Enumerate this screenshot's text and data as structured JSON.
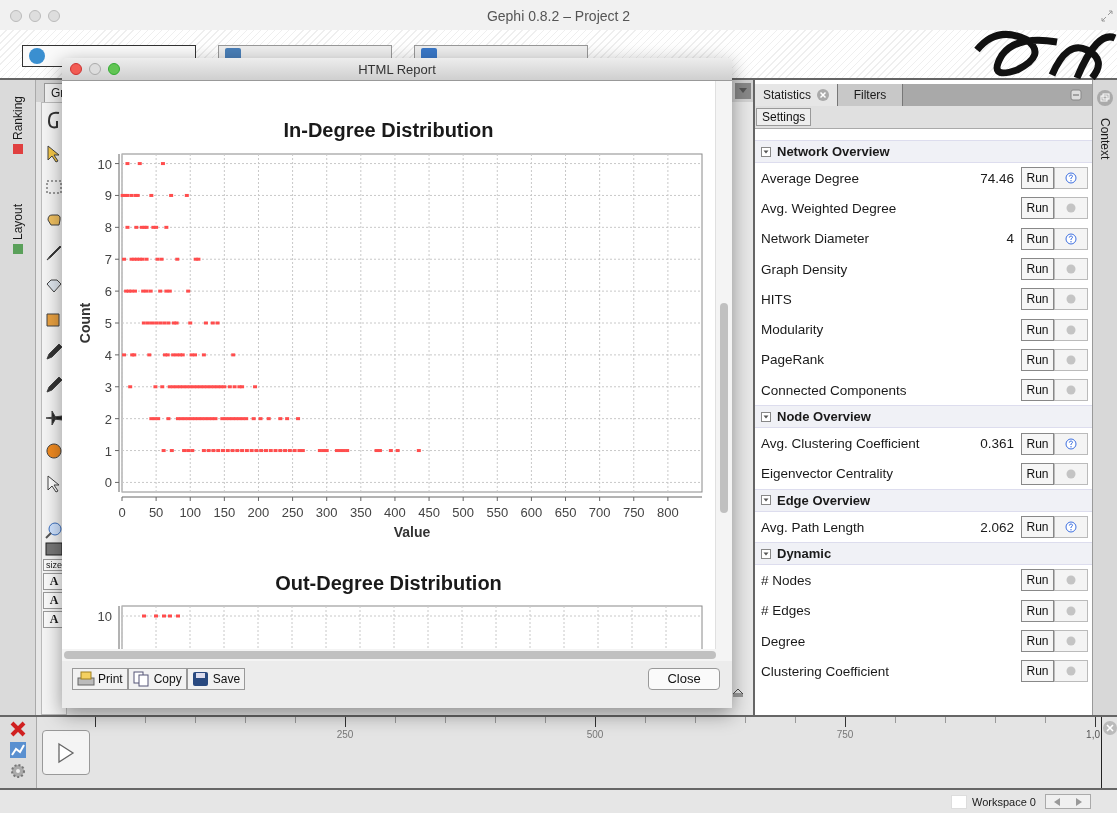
{
  "window": {
    "title": "Gephi 0.8.2 – Project 2"
  },
  "perspectives": [
    {
      "selected": true
    },
    {
      "selected": false
    },
    {
      "selected": false
    }
  ],
  "left_tabs": [
    {
      "label": "Ranking"
    },
    {
      "label": "Layout"
    }
  ],
  "graph_panel": {
    "tab": "Gr",
    "text_buttons": [
      "size",
      "A",
      "A",
      "A"
    ]
  },
  "report": {
    "title": "HTML Report",
    "charts": [
      {
        "chart_data": {
          "type": "scatter",
          "title": "In-Degree Distribution",
          "xlabel": "Value",
          "ylabel": "Count",
          "xlim": [
            0,
            850
          ],
          "ylim": [
            -0.3,
            10.3
          ],
          "grid": true,
          "xticks": [
            0,
            50,
            100,
            150,
            200,
            250,
            300,
            350,
            400,
            450,
            500,
            550,
            600,
            650,
            700,
            750,
            800
          ],
          "yticks": [
            0,
            1,
            2,
            3,
            4,
            5,
            6,
            7,
            8,
            9,
            10
          ],
          "x": [
            8,
            26,
            60,
            1,
            5,
            8,
            14,
            20,
            23,
            43,
            72,
            95,
            8,
            21,
            29,
            33,
            36,
            46,
            50,
            65,
            3,
            14,
            18,
            22,
            26,
            30,
            36,
            52,
            58,
            81,
            108,
            112,
            6,
            10,
            14,
            19,
            31,
            36,
            42,
            56,
            65,
            70,
            97,
            32,
            38,
            44,
            50,
            56,
            62,
            68,
            76,
            80,
            100,
            123,
            133,
            140,
            3,
            15,
            18,
            40,
            63,
            67,
            75,
            80,
            85,
            89,
            102,
            107,
            120,
            163,
            12,
            49,
            59,
            70,
            75,
            80,
            85,
            90,
            95,
            100,
            105,
            110,
            115,
            120,
            125,
            130,
            135,
            140,
            145,
            150,
            158,
            165,
            172,
            176,
            195,
            43,
            48,
            53,
            68,
            82,
            87,
            92,
            97,
            102,
            107,
            112,
            117,
            122,
            127,
            132,
            137,
            147,
            152,
            157,
            162,
            167,
            172,
            177,
            182,
            193,
            203,
            215,
            232,
            242,
            258,
            61,
            73,
            91,
            97,
            103,
            120,
            127,
            134,
            141,
            148,
            155,
            162,
            169,
            176,
            183,
            190,
            197,
            204,
            211,
            218,
            225,
            232,
            239,
            246,
            253,
            260,
            265,
            290,
            295,
            300,
            315,
            320,
            325,
            330,
            373,
            378,
            394,
            404,
            435
          ],
          "series": [
            {
              "color": "#ff4d4d",
              "values": [
                10,
                10,
                10,
                9,
                9,
                9,
                9,
                9,
                9,
                9,
                9,
                9,
                8,
                8,
                8,
                8,
                8,
                8,
                8,
                8,
                7,
                7,
                7,
                7,
                7,
                7,
                7,
                7,
                7,
                7,
                7,
                7,
                6,
                6,
                6,
                6,
                6,
                6,
                6,
                6,
                6,
                6,
                6,
                5,
                5,
                5,
                5,
                5,
                5,
                5,
                5,
                5,
                5,
                5,
                5,
                5,
                4,
                4,
                4,
                4,
                4,
                4,
                4,
                4,
                4,
                4,
                4,
                4,
                4,
                4,
                3,
                3,
                3,
                3,
                3,
                3,
                3,
                3,
                3,
                3,
                3,
                3,
                3,
                3,
                3,
                3,
                3,
                3,
                3,
                3,
                3,
                3,
                3,
                3,
                3,
                2,
                2,
                2,
                2,
                2,
                2,
                2,
                2,
                2,
                2,
                2,
                2,
                2,
                2,
                2,
                2,
                2,
                2,
                2,
                2,
                2,
                2,
                2,
                2,
                2,
                2,
                2,
                2,
                2,
                2,
                1,
                1,
                1,
                1,
                1,
                1,
                1,
                1,
                1,
                1,
                1,
                1,
                1,
                1,
                1,
                1,
                1,
                1,
                1,
                1,
                1,
                1,
                1,
                1,
                1,
                1,
                1,
                1,
                1,
                1,
                1,
                1,
                1,
                1,
                1,
                1,
                1,
                1,
                1
              ]
            }
          ]
        }
      },
      {
        "title": "Out-Degree Distribution",
        "ytick": "10"
      }
    ],
    "buttons": [
      "Print",
      "Copy",
      "Save"
    ],
    "close": "Close"
  },
  "statistics": {
    "tabs": [
      {
        "label": "Statistics",
        "selected": true
      },
      {
        "label": "Filters",
        "selected": false
      }
    ],
    "settings": "Settings",
    "sections": [
      {
        "title": "Network Overview",
        "expanded": true,
        "rows": [
          {
            "name": "Average Degree",
            "value": "74.46",
            "run": "Run",
            "has_report": true
          },
          {
            "name": "Avg. Weighted Degree",
            "run": "Run",
            "has_report": false
          },
          {
            "name": "Network Diameter",
            "value": "4",
            "run": "Run",
            "has_report": true
          },
          {
            "name": "Graph Density",
            "run": "Run",
            "has_report": false
          },
          {
            "name": "HITS",
            "run": "Run",
            "has_report": false
          },
          {
            "name": "Modularity",
            "run": "Run",
            "has_report": false
          },
          {
            "name": "PageRank",
            "run": "Run",
            "has_report": false
          },
          {
            "name": "Connected Components",
            "run": "Run",
            "has_report": false
          }
        ]
      },
      {
        "title": "Node Overview",
        "expanded": true,
        "rows": [
          {
            "name": "Avg. Clustering Coefficient",
            "value": "0.361",
            "run": "Run",
            "has_report": true
          },
          {
            "name": "Eigenvector Centrality",
            "run": "Run",
            "has_report": false
          }
        ]
      },
      {
        "title": "Edge Overview",
        "expanded": true,
        "rows": [
          {
            "name": "Avg. Path Length",
            "value": "2.062",
            "run": "Run",
            "has_report": true
          }
        ]
      },
      {
        "title": "Dynamic",
        "expanded": true,
        "rows": [
          {
            "name": "# Nodes",
            "run": "Run",
            "has_report": false
          },
          {
            "name": "# Edges",
            "run": "Run",
            "has_report": false
          },
          {
            "name": "Degree",
            "run": "Run",
            "has_report": false
          },
          {
            "name": "Clustering Coefficient",
            "run": "Run",
            "has_report": false
          }
        ]
      }
    ]
  },
  "context_tab": "Context",
  "timeline": {
    "ticks": [
      "250",
      "500",
      "750",
      "1,0"
    ]
  },
  "status_bar": {
    "workspace": "Workspace 0"
  }
}
